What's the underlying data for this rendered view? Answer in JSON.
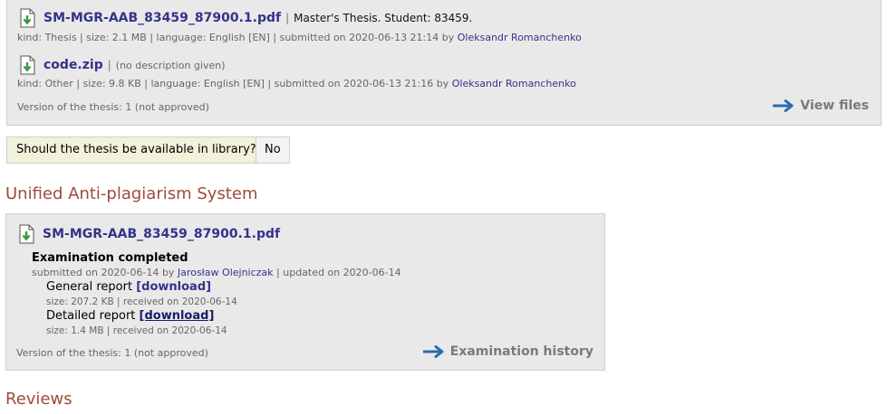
{
  "files": [
    {
      "name": "SM-MGR-AAB_83459_87900.1.pdf",
      "description": "Master's Thesis. Student: 83459.",
      "meta_prefix": "kind: Thesis | size: 2.1 MB | language: English [EN] | submitted on 2020-06-13 21:14 by",
      "author": "Oleksandr Romanchenko"
    },
    {
      "name": "code.zip",
      "description": "(no description given)",
      "meta_prefix": "kind: Other | size: 9.8 KB | language: English [EN] | submitted on 2020-06-13 21:16 by",
      "author": "Oleksandr Romanchenko"
    }
  ],
  "files_version": "Version of the thesis: 1 (not approved)",
  "view_files_label": "View files",
  "library": {
    "question": "Should the thesis be available in library?",
    "answer": "No"
  },
  "anti_plagiarism": {
    "title": "Unified Anti-plagiarism System",
    "file_name": "SM-MGR-AAB_83459_87900.1.pdf",
    "status": "Examination completed",
    "submitted_prefix": "submitted on 2020-06-14 by",
    "submitted_by": "Jarosław Olejniczak",
    "updated": "| updated on 2020-06-14",
    "general_label": "General report",
    "general_link": "[download]",
    "general_meta": "size: 207.2 KB | received on 2020-06-14",
    "detailed_label": "Detailed report",
    "detailed_link": "[download]",
    "detailed_meta": "size: 1.4 MB | received on 2020-06-14",
    "version": "Version of the thesis: 1 (not approved)",
    "history_label": "Examination history"
  },
  "reviews_title": "Reviews",
  "colors": {
    "link": "#33338a",
    "section_title": "#a04a3c",
    "arrow": "#2a6bb0",
    "panel": "#e9e9e9"
  },
  "icons": {
    "file": "file-download-icon",
    "arrow": "arrow-right-icon"
  }
}
